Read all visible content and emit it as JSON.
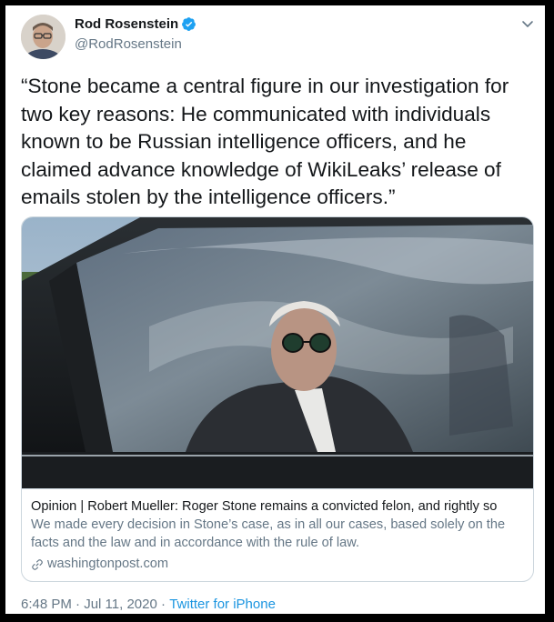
{
  "author": {
    "display_name": "Rod Rosenstein",
    "handle": "@RodRosenstein",
    "verified_icon": "verified-badge-icon",
    "accent_color": "#1da1f2"
  },
  "tweet": {
    "text": "“Stone became a central figure in our investigation for two key reasons: He communicated with individuals known to be Russian intelligence officers, and he claimed advance knowledge of WikiLeaks’ release of emails stolen by the intelligence officers.”"
  },
  "card": {
    "title": "Opinion | Robert Mueller: Roger Stone remains a convicted felon, and rightly so",
    "description": "We made every decision in Stone’s case, as in all our cases, based solely on the facts and the law and in accordance with the rule of law.",
    "domain": "washingtonpost.com",
    "domain_icon": "link-icon"
  },
  "meta": {
    "time": "6:48 PM",
    "separator": " · ",
    "date": "Jul 11, 2020",
    "source": "Twitter for iPhone"
  }
}
